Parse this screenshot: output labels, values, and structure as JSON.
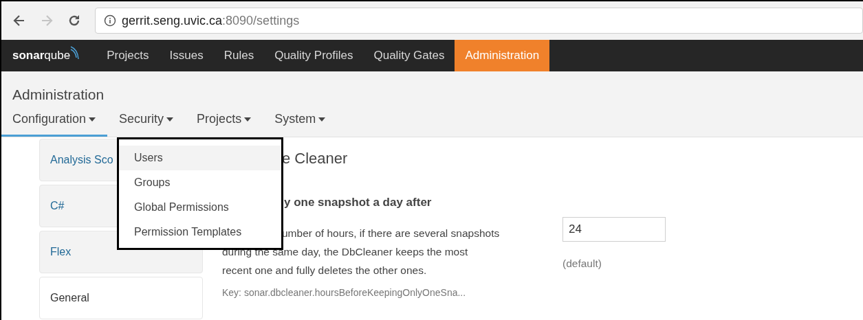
{
  "browser": {
    "address": {
      "host": "gerrit.seng.uvic.ca",
      "rest": ":8090/settings"
    },
    "forward_disabled": true
  },
  "navbar": {
    "logo": {
      "bold": "sonar",
      "light": "qube"
    },
    "items": [
      {
        "label": "Projects",
        "selected": false
      },
      {
        "label": "Issues",
        "selected": false
      },
      {
        "label": "Rules",
        "selected": false
      },
      {
        "label": "Quality Profiles",
        "selected": false
      },
      {
        "label": "Quality Gates",
        "selected": false
      },
      {
        "label": "Administration",
        "selected": true
      }
    ]
  },
  "page_title": "Administration",
  "admin_tabs": [
    {
      "label": "Configuration",
      "selected": true
    },
    {
      "label": "Security",
      "selected": false
    },
    {
      "label": "Projects",
      "selected": false
    },
    {
      "label": "System",
      "selected": false
    }
  ],
  "dropdown": {
    "items": [
      {
        "label": "Users",
        "selected": true
      },
      {
        "label": "Groups",
        "selected": false
      },
      {
        "label": "Global Permissions",
        "selected": false
      },
      {
        "label": "Permission Templates",
        "selected": false
      }
    ]
  },
  "sidebar": {
    "items": [
      {
        "label": "Analysis Sco",
        "selected": false
      },
      {
        "label": "C#",
        "selected": false
      },
      {
        "label": "Flex",
        "selected": false
      },
      {
        "label": "General",
        "selected": true
      }
    ]
  },
  "section": {
    "title": "e Cleaner",
    "setting": {
      "name": "y one snapshot a day after",
      "description_lines": [
        "umber of hours, if there are several snapshots",
        "during the same day, the DbCleaner keeps the most",
        "recent one and fully deletes the other ones."
      ],
      "key": "Key: sonar.dbcleaner.hoursBeforeKeepingOnlyOneSna...",
      "value": "24",
      "default_label": "(default)"
    }
  }
}
